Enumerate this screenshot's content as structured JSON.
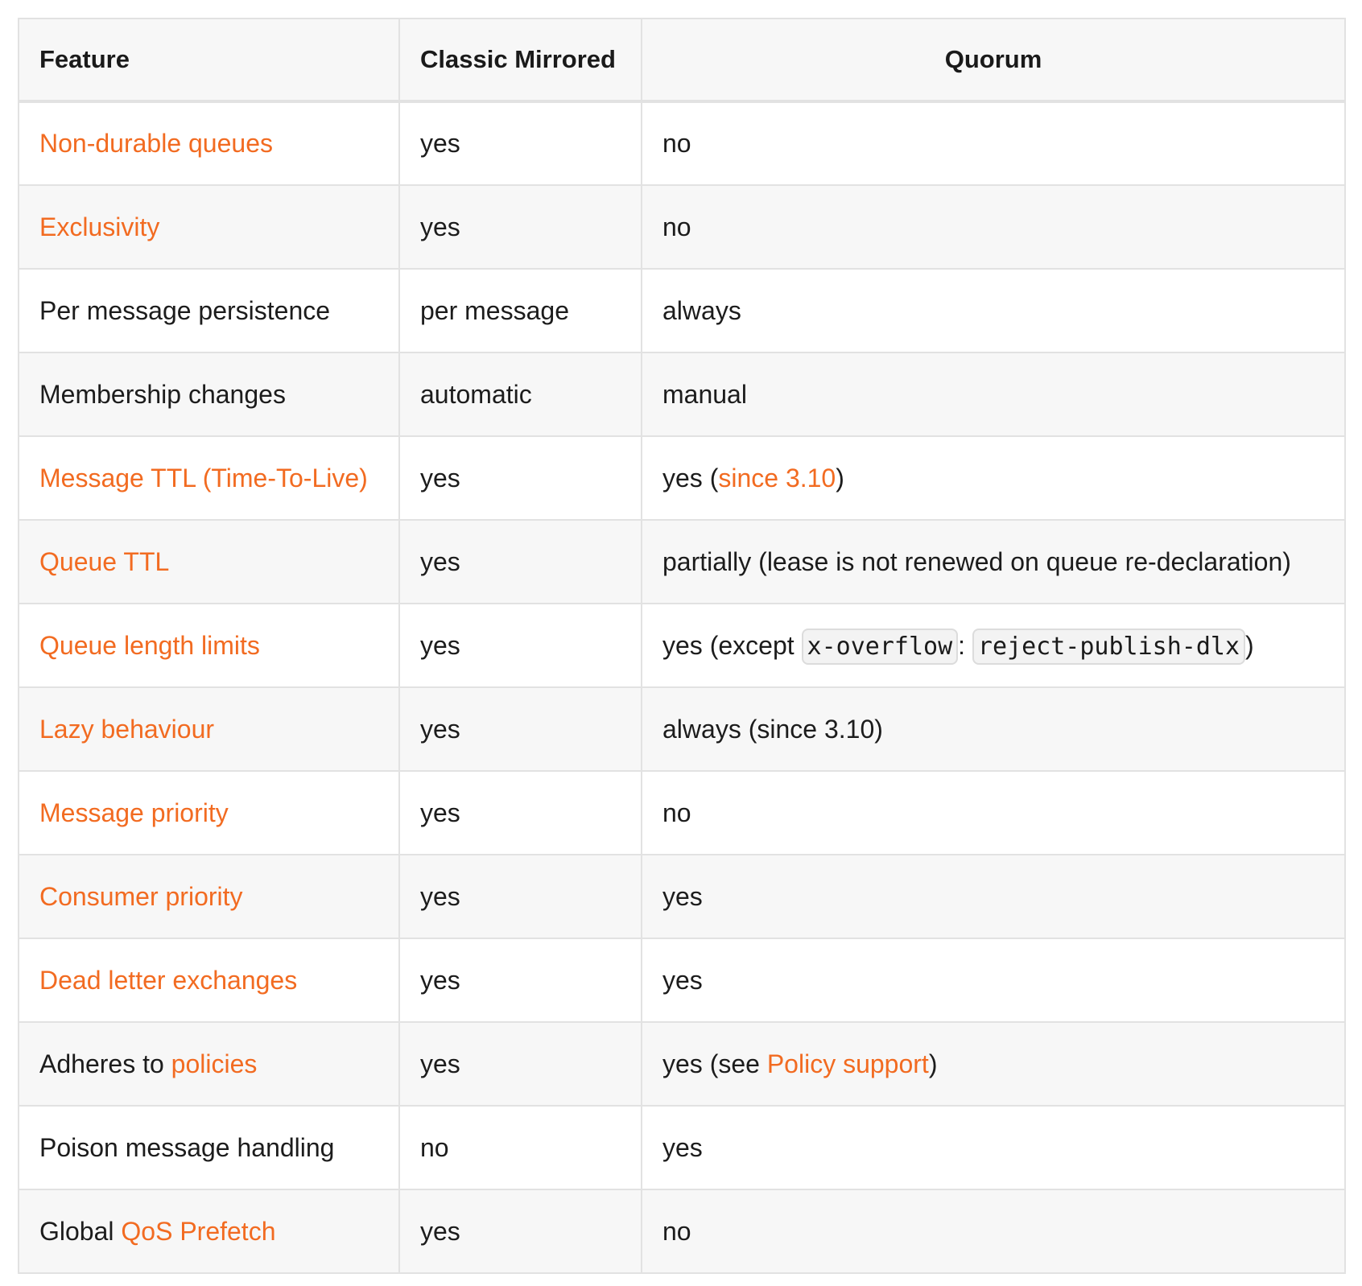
{
  "colors": {
    "link": "#f26b21",
    "header_bg": "#f7f7f7",
    "stripe_bg": "#f7f7f7",
    "border": "#e2e2e2",
    "text": "#1c1c1c"
  },
  "headers": [
    "Feature",
    "Classic Mirrored",
    "Quorum"
  ],
  "rows": [
    {
      "feature": [
        {
          "text": "Non-durable queues",
          "link": true
        }
      ],
      "classic": [
        {
          "text": "yes"
        }
      ],
      "quorum": [
        {
          "text": "no"
        }
      ]
    },
    {
      "feature": [
        {
          "text": "Exclusivity",
          "link": true
        }
      ],
      "classic": [
        {
          "text": "yes"
        }
      ],
      "quorum": [
        {
          "text": "no"
        }
      ]
    },
    {
      "feature": [
        {
          "text": "Per message persistence"
        }
      ],
      "classic": [
        {
          "text": "per message"
        }
      ],
      "quorum": [
        {
          "text": "always"
        }
      ]
    },
    {
      "feature": [
        {
          "text": "Membership changes"
        }
      ],
      "classic": [
        {
          "text": "automatic"
        }
      ],
      "quorum": [
        {
          "text": "manual"
        }
      ]
    },
    {
      "feature": [
        {
          "text": "Message TTL (Time-To-Live)",
          "link": true
        }
      ],
      "classic": [
        {
          "text": "yes"
        }
      ],
      "quorum": [
        {
          "text": "yes ("
        },
        {
          "text": "since 3.10",
          "link": true
        },
        {
          "text": ")"
        }
      ]
    },
    {
      "feature": [
        {
          "text": "Queue TTL",
          "link": true
        }
      ],
      "classic": [
        {
          "text": "yes"
        }
      ],
      "quorum": [
        {
          "text": "partially (lease is not renewed on queue re-declaration)"
        }
      ]
    },
    {
      "feature": [
        {
          "text": "Queue length limits",
          "link": true
        }
      ],
      "classic": [
        {
          "text": "yes"
        }
      ],
      "quorum": [
        {
          "text": "yes (except "
        },
        {
          "text": "x-overflow",
          "code": true
        },
        {
          "text": ": "
        },
        {
          "text": "reject-publish-dlx",
          "code": true
        },
        {
          "text": ")"
        }
      ]
    },
    {
      "feature": [
        {
          "text": "Lazy behaviour",
          "link": true
        }
      ],
      "classic": [
        {
          "text": "yes"
        }
      ],
      "quorum": [
        {
          "text": "always (since 3.10)"
        }
      ]
    },
    {
      "feature": [
        {
          "text": "Message priority",
          "link": true
        }
      ],
      "classic": [
        {
          "text": "yes"
        }
      ],
      "quorum": [
        {
          "text": "no"
        }
      ]
    },
    {
      "feature": [
        {
          "text": "Consumer priority",
          "link": true
        }
      ],
      "classic": [
        {
          "text": "yes"
        }
      ],
      "quorum": [
        {
          "text": "yes"
        }
      ]
    },
    {
      "feature": [
        {
          "text": "Dead letter exchanges",
          "link": true
        }
      ],
      "classic": [
        {
          "text": "yes"
        }
      ],
      "quorum": [
        {
          "text": "yes"
        }
      ]
    },
    {
      "feature": [
        {
          "text": "Adheres to "
        },
        {
          "text": "policies",
          "link": true
        }
      ],
      "classic": [
        {
          "text": "yes"
        }
      ],
      "quorum": [
        {
          "text": "yes (see "
        },
        {
          "text": "Policy support",
          "link": true
        },
        {
          "text": ")"
        }
      ]
    },
    {
      "feature": [
        {
          "text": "Poison message handling"
        }
      ],
      "classic": [
        {
          "text": "no"
        }
      ],
      "quorum": [
        {
          "text": "yes"
        }
      ]
    },
    {
      "feature": [
        {
          "text": "Global "
        },
        {
          "text": "QoS Prefetch",
          "link": true
        }
      ],
      "classic": [
        {
          "text": "yes"
        }
      ],
      "quorum": [
        {
          "text": "no"
        }
      ]
    }
  ]
}
